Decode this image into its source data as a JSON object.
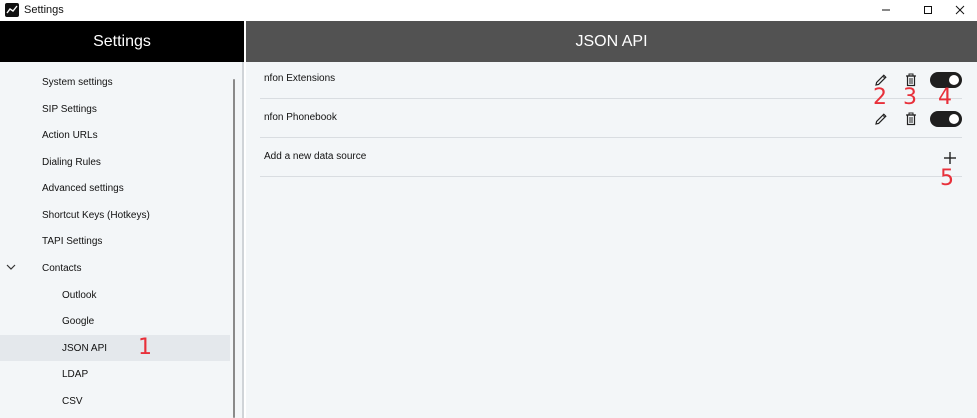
{
  "window": {
    "title": "Settings",
    "icon": "app-chart-icon"
  },
  "sidebar": {
    "header": "Settings",
    "items": [
      {
        "label": "System settings"
      },
      {
        "label": "SIP Settings"
      },
      {
        "label": "Action URLs"
      },
      {
        "label": "Dialing Rules"
      },
      {
        "label": "Advanced settings"
      },
      {
        "label": "Shortcut Keys (Hotkeys)"
      },
      {
        "label": "TAPI Settings"
      },
      {
        "label": "Contacts",
        "expanded": true
      },
      {
        "label": "Outlook"
      },
      {
        "label": "Google"
      },
      {
        "label": "JSON API",
        "selected": true
      },
      {
        "label": "LDAP"
      },
      {
        "label": "CSV"
      }
    ]
  },
  "main": {
    "header": "JSON API",
    "sources": [
      {
        "label": "nfon Extensions",
        "enabled": true
      },
      {
        "label": "nfon Phonebook",
        "enabled": true
      }
    ],
    "add_label": "Add a new data source"
  },
  "annotations": [
    "1",
    "2",
    "3",
    "4",
    "5"
  ],
  "colors": {
    "sidebar_header": "#000000",
    "main_header": "#525252",
    "annotation": "#e8303a",
    "toggle_on": "#1f1f1f"
  }
}
